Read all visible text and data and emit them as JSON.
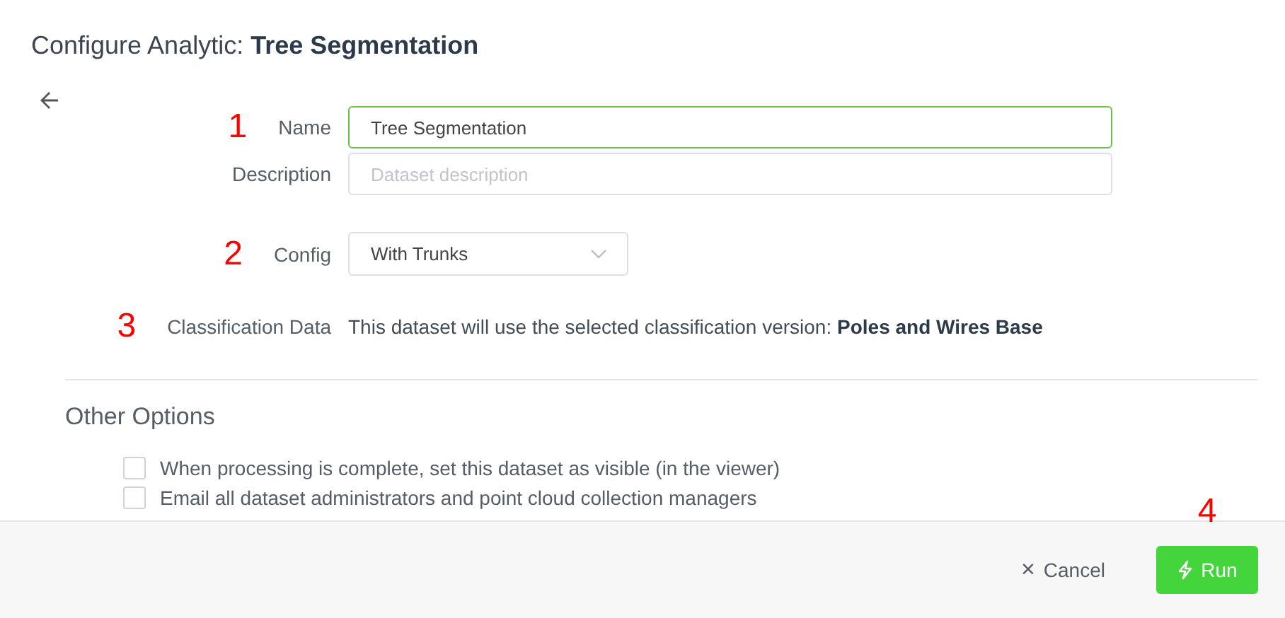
{
  "dialog": {
    "title_prefix": "Configure Analytic:",
    "title_name": "Tree Segmentation"
  },
  "fields": [
    {
      "kind": "text",
      "marker": "1",
      "label": "Name",
      "value": "Tree Segmentation",
      "focused": true
    },
    {
      "kind": "text",
      "label": "Description",
      "placeholder": "Dataset description",
      "focused": false
    },
    {
      "kind": "select",
      "marker": "2",
      "label": "Config",
      "value": "With Trunks"
    },
    {
      "kind": "info",
      "marker": "3",
      "label": "Classification Data",
      "text": "This dataset will use the selected classification version: **Poles and Wires Base**"
    }
  ],
  "other_options": {
    "title": "Other Options",
    "checkboxes": [
      {
        "label": "When processing is complete, set this dataset as visible (in the viewer)",
        "checked": false
      },
      {
        "label": "Email all dataset administrators and point cloud collection managers",
        "checked": false
      }
    ]
  },
  "footer": {
    "buttons": [
      {
        "kind": "cancel",
        "icon": "×",
        "label": "Cancel"
      },
      {
        "kind": "run",
        "label": "Run",
        "marker": "4"
      }
    ]
  }
}
